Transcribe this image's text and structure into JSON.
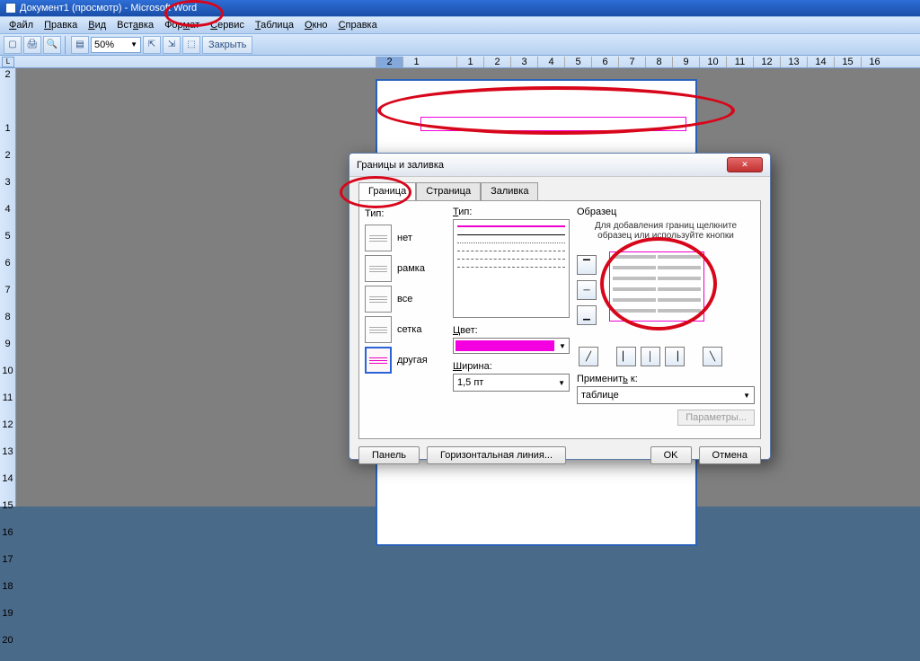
{
  "window": {
    "title": "Документ1 (просмотр) - Microsoft Word"
  },
  "menu": [
    "Файл",
    "Правка",
    "Вид",
    "Вставка",
    "Формат",
    "Сервис",
    "Таблица",
    "Окно",
    "Справка"
  ],
  "toolbar": {
    "zoom": "50%",
    "close": "Закрыть"
  },
  "hruler": [
    "2",
    "1",
    "",
    "1",
    "2",
    "3",
    "4",
    "5",
    "6",
    "7",
    "8",
    "9",
    "10",
    "11",
    "12",
    "13",
    "14",
    "15",
    "16",
    ""
  ],
  "vruler": [
    "2",
    "",
    "1",
    "2",
    "3",
    "4",
    "5",
    "6",
    "7",
    "8",
    "9",
    "10",
    "11",
    "12",
    "13",
    "14",
    "15",
    "16",
    "17",
    "18",
    "19",
    "20"
  ],
  "dialog": {
    "title": "Границы и заливка",
    "tabs": [
      "Граница",
      "Страница",
      "Заливка"
    ],
    "typelist_label": "Тип:",
    "typeopts": [
      "нет",
      "рамка",
      "все",
      "сетка",
      "другая"
    ],
    "style_label": "Тип:",
    "color_label": "Цвет:",
    "width_label": "Ширина:",
    "width_value": "1,5 пт",
    "sample_label": "Образец",
    "sample_note": "Для добавления границ щелкните образец или используйте кнопки",
    "apply_label": "Применить к:",
    "apply_value": "таблице",
    "params_btn": "Параметры...",
    "panel_btn": "Панель",
    "hline_btn": "Горизонтальная линия...",
    "ok": "OK",
    "cancel": "Отмена"
  }
}
